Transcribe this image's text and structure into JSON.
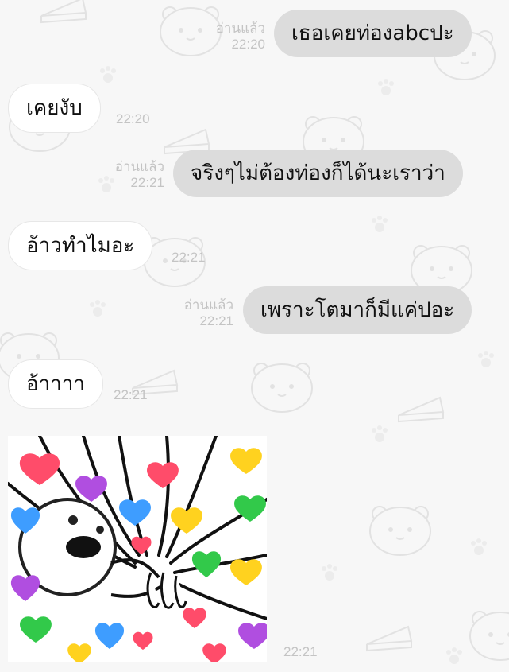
{
  "messages": [
    {
      "side": "sent",
      "text": "เธอเคยท่องabcปะ",
      "read_label": "อ่านแล้ว",
      "time": "22:20"
    },
    {
      "side": "received",
      "text": "เคยงับ",
      "time": "22:20"
    },
    {
      "side": "sent",
      "text": "จริงๆไม่ต้องท่องก็ได้นะเราว่า",
      "read_label": "อ่านแล้ว",
      "time": "22:21"
    },
    {
      "side": "received",
      "text": "อ้าวทำไมอะ",
      "time": "22:21"
    },
    {
      "side": "sent",
      "text": "เพราะโตมาก็มีแค่ปอะ",
      "read_label": "อ่านแล้ว",
      "time": "22:21"
    },
    {
      "side": "received",
      "text": "อ้าาาา",
      "time": "22:21"
    },
    {
      "side": "received",
      "type": "sticker",
      "sticker": "heart-hands-sticker",
      "time": "22:21"
    }
  ],
  "colors": {
    "background": "#f7f7f7",
    "sent_bubble": "#dcdcdc",
    "received_bubble": "#ffffff",
    "meta_text": "#c4c4c4"
  }
}
